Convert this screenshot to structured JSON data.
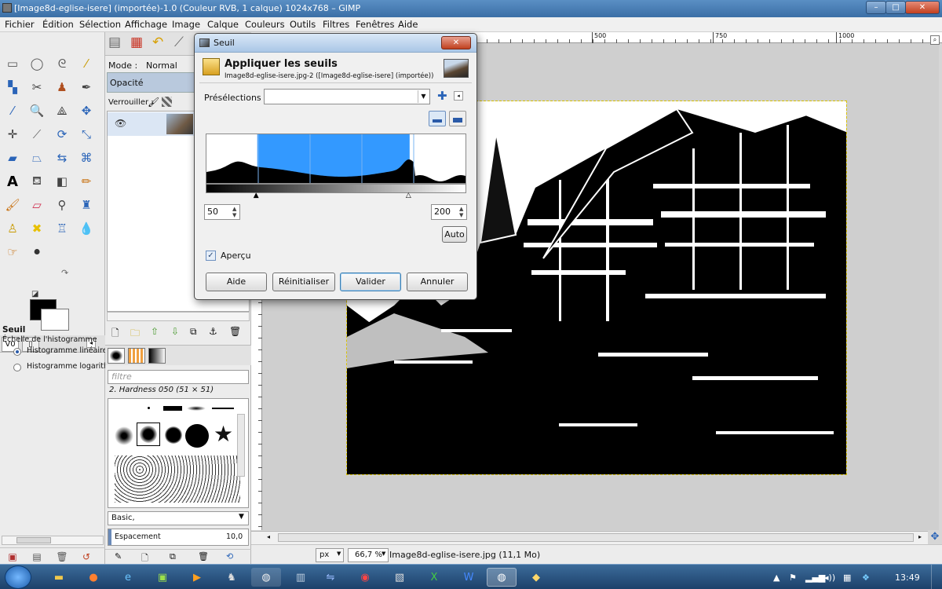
{
  "window": {
    "title": "[Image8d-eglise-isere] (importée)-1.0 (Couleur RVB, 1 calque) 1024x768 – GIMP",
    "controls": {
      "minimize": "–",
      "maximize": "□",
      "close": "✕"
    }
  },
  "menubar": [
    "Fichier",
    "Édition",
    "Sélection",
    "Affichage",
    "Image",
    "Calque",
    "Couleurs",
    "Outils",
    "Filtres",
    "Fenêtres",
    "Aide"
  ],
  "toolbox": {
    "tools": [
      "rect-select",
      "ellipse-select",
      "free-select",
      "fuzzy-select",
      "select-by-color",
      "scissors",
      "foreground-select",
      "paths",
      "color-picker",
      "zoom",
      "measure",
      "move",
      "align",
      "crop",
      "rotate",
      "scale",
      "shear",
      "perspective",
      "flip",
      "cage",
      "text",
      "bucket-fill",
      "blend",
      "pencil",
      "paintbrush",
      "eraser",
      "airbrush",
      "ink",
      "clone",
      "heal",
      "perspective-clone",
      "blur",
      "smudge",
      "dodge-burn"
    ],
    "tool_options": {
      "title": "Seuil",
      "subtitle": "Échelle de l'histogramme",
      "options": [
        "Histogramme linéaire",
        "Histogramme logarithmique"
      ],
      "selected": 0
    }
  },
  "layers": {
    "mode_label": "Mode :",
    "mode_value": "Normal",
    "opacity_label": "Opacité",
    "lock_label": "Verrouiller :"
  },
  "brushes": {
    "filter_placeholder": "filtre",
    "selected_brush": "2. Hardness 050 (51 × 51)",
    "preset": "Basic,",
    "spacing_label": "Espacement",
    "spacing_value": "10,0"
  },
  "dialog": {
    "window_title": "Seuil",
    "heading": "Appliquer les seuils",
    "image_ref": "Image8d-eglise-isere.jpg-2 ([Image8d-eglise-isere] (importée))",
    "presets_label": "Présélections :",
    "presets_value": "",
    "low": "50",
    "high": "200",
    "low_level": 50,
    "high_level": 200,
    "auto_label": "Auto",
    "preview_label": "Aperçu",
    "preview_checked": true,
    "buttons": {
      "help": "Aide",
      "reset": "Réinitialiser",
      "ok": "Valider",
      "cancel": "Annuler"
    },
    "histogram_color": "#3399ff"
  },
  "rulers": {
    "top_marks": [
      "500",
      "750",
      "1000"
    ]
  },
  "status": {
    "unit": "px",
    "zoom": "66,7 %",
    "info": "Image8d-eglise-isere.jpg (11,1 Mo)"
  },
  "taskbar": {
    "clock": "13:49",
    "apps": [
      "explorer",
      "firefox",
      "ie",
      "app4",
      "media",
      "app6",
      "gimp-old",
      "app8",
      "app9",
      "chrome",
      "app11",
      "excel",
      "word",
      "gimp",
      "app15"
    ]
  }
}
